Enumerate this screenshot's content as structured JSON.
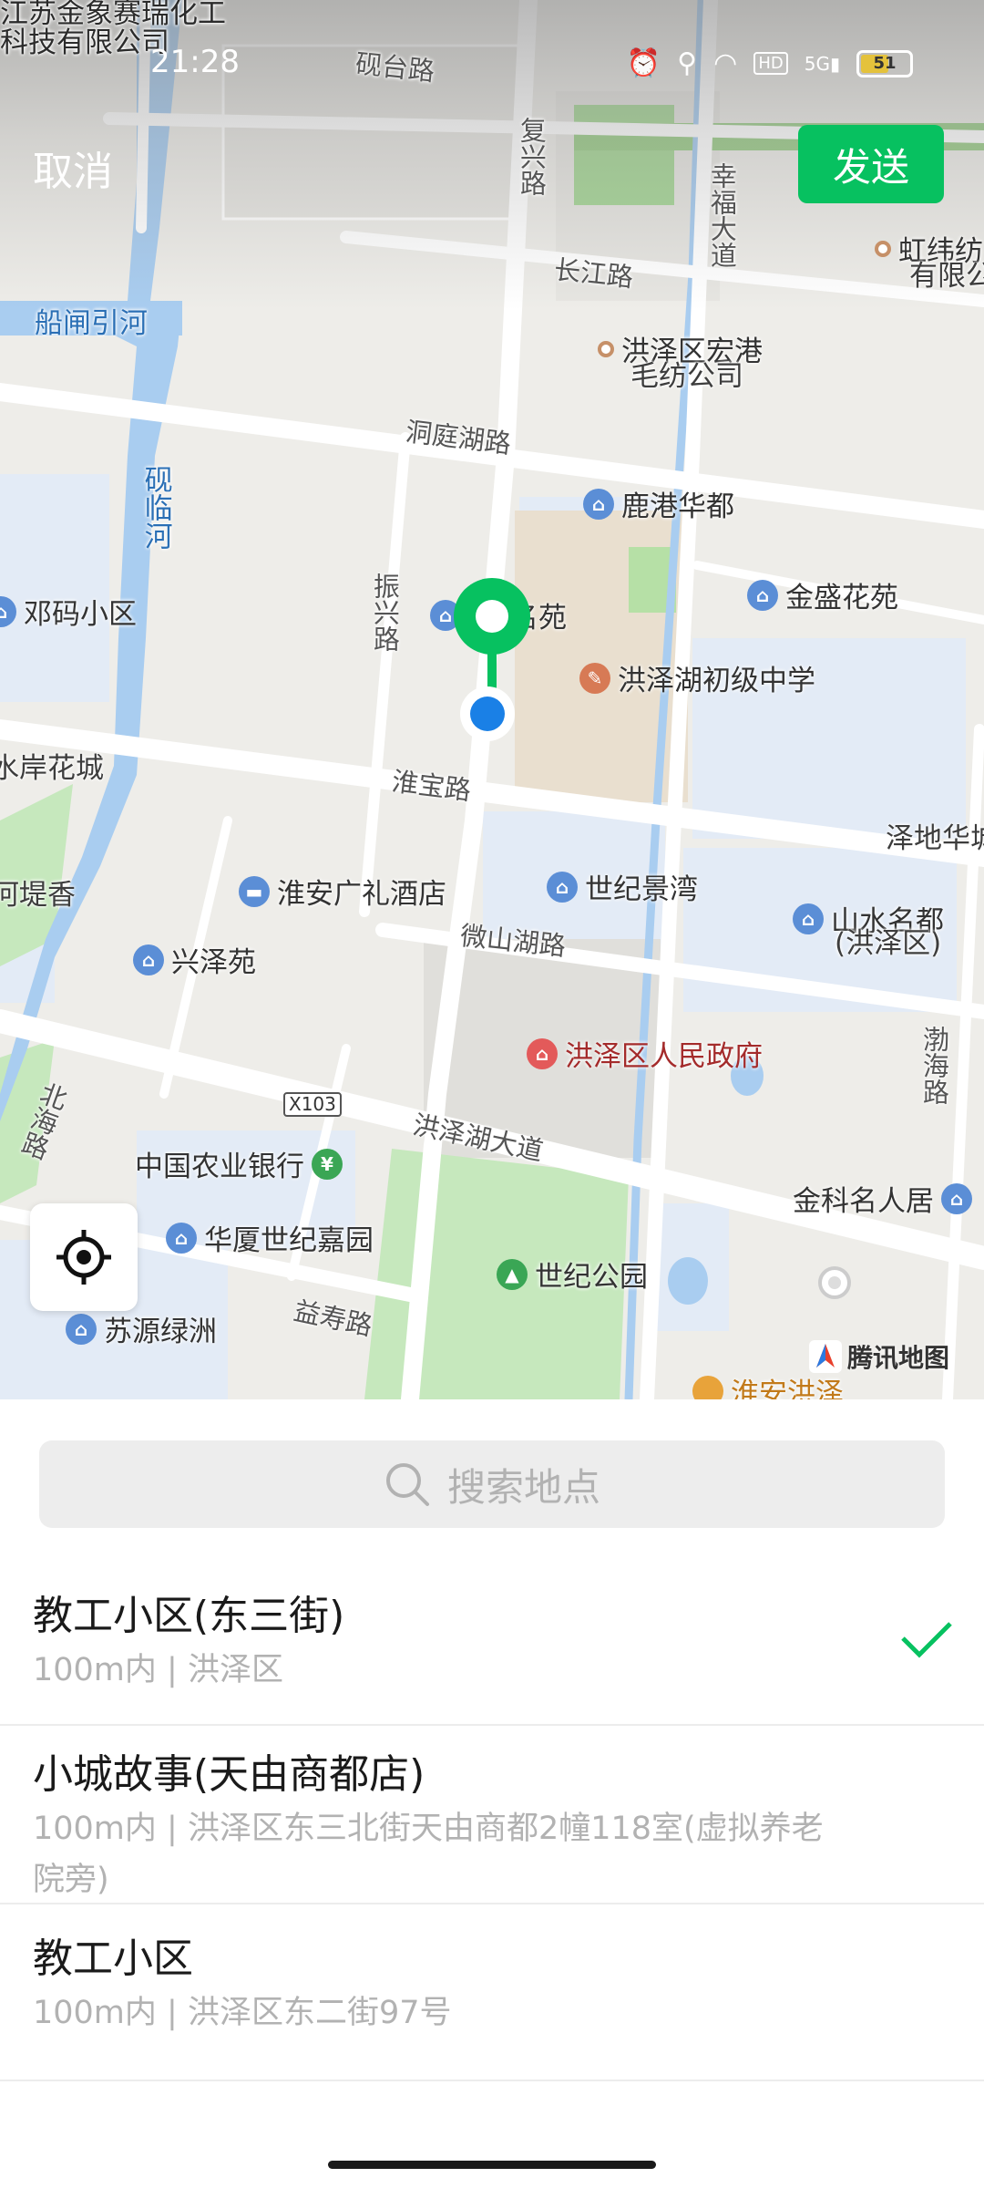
{
  "status_bar": {
    "time": "21:28",
    "battery": "51",
    "network": "5G"
  },
  "header": {
    "cancel_label": "取消",
    "send_label": "发送"
  },
  "map": {
    "labels": {
      "company_top_left_1": "江苏金象赛瑞化工",
      "company_top_left_2": "科技有限公司",
      "yantai_road": "砚台路",
      "fuxing_road": "复兴路",
      "xingfu_avenue": "幸福大道",
      "changjiang_road": "长江路",
      "hongwei_1": "虹纬纺",
      "hongwei_2": "有限公",
      "chuanzha_river": "船闸引河",
      "honggang_1": "洪泽区宏港",
      "honggang_2": "毛纺公司",
      "dongting_road": "洞庭湖路",
      "yanlin_river": "砚临河",
      "lugang_huadu": "鹿港华都",
      "dengma": "邓码小区",
      "zhenxing_road": "振兴路",
      "mingyuan": "名苑",
      "jinsheng": "金盛花苑",
      "school": "洪泽湖初级中学",
      "shuian": "水岸花城",
      "huaibao_road": "淮宝路",
      "zedi": "泽地华城",
      "hedi": "河堤香",
      "guangli_hotel": "淮安广礼酒店",
      "shiji_jingwan": "世纪景湾",
      "shanshui_1": "山水名都",
      "shanshui_2": "(洪泽区)",
      "xingze": "兴泽苑",
      "weishan_road": "微山湖路",
      "gov": "洪泽区人民政府",
      "bohai_road": "渤海路",
      "x103": "X103",
      "beihai_road": "北海路",
      "hongzehu_avenue": "洪泽湖大道",
      "abc_bank": "中国农业银行",
      "jinke": "金科名人居",
      "huaxia": "华厦世纪嘉园",
      "century_park": "世纪公园",
      "yishou_road": "益寿路",
      "suyuan": "苏源绿洲",
      "huaian_hongze": "淮安洪泽",
      "tencent_map": "腾讯地图"
    }
  },
  "search": {
    "placeholder": "搜索地点"
  },
  "results": [
    {
      "name": "教工小区(东三街)",
      "detail": "100m内 | 洪泽区",
      "selected": true
    },
    {
      "name": "小城故事(天由商都店)",
      "detail": "100m内 | 洪泽区东三北街天由商都2幢118室(虚拟养老院旁)",
      "selected": false
    },
    {
      "name": "教工小区",
      "detail": "100m内 | 洪泽区东二街97号",
      "selected": false
    }
  ],
  "colors": {
    "accent": "#07c160",
    "water": "#a9cdf0",
    "park": "#c6e8bd",
    "pin_green": "#07c160",
    "location_blue": "#1a80e6"
  }
}
